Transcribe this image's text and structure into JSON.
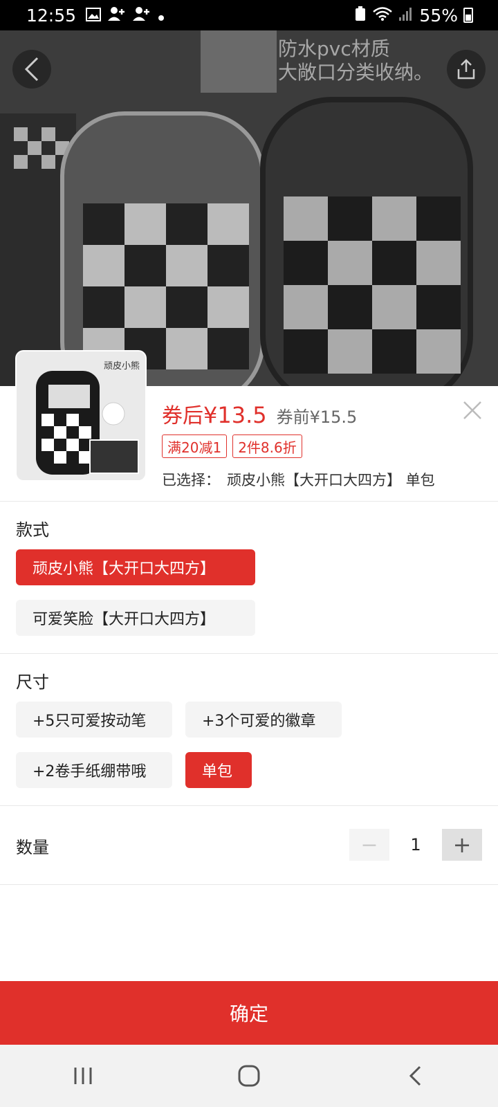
{
  "status_bar": {
    "time": "12:55",
    "battery": "55%",
    "icons": [
      "image-icon",
      "person-add-icon",
      "person-add-icon",
      "dot-icon",
      "wifi-icon",
      "signal-icon",
      "battery-icon"
    ]
  },
  "hero": {
    "overlay_text_lines": [
      "防水pvc材质",
      "大敞口分类收纳。"
    ]
  },
  "product": {
    "thumb_tag": "顽皮小熊",
    "price_label": "券后",
    "price_value": "¥13.5",
    "price_before": "券前¥15.5",
    "promos": [
      "满20减1",
      "2件8.6折"
    ],
    "selected_label": "已选择：",
    "selected_value": "顽皮小熊【大开口大四方】 单包"
  },
  "style_section": {
    "title": "款式",
    "options": [
      {
        "label": "顽皮小熊【大开口大四方】",
        "selected": true
      },
      {
        "label": "可爱笑脸【大开口大四方】",
        "selected": false
      }
    ]
  },
  "size_section": {
    "title": "尺寸",
    "options": [
      {
        "label": "+5只可爱按动笔",
        "selected": false
      },
      {
        "label": "+3个可爱的徽章",
        "selected": false
      },
      {
        "label": "+2卷手纸绷带哦",
        "selected": false
      },
      {
        "label": "单包",
        "selected": true
      }
    ]
  },
  "quantity": {
    "label": "数量",
    "value": "1",
    "minus": "−",
    "plus": "+"
  },
  "confirm_button": "确定",
  "colors": {
    "accent": "#e0302b",
    "option_bg": "#f4f4f4"
  }
}
